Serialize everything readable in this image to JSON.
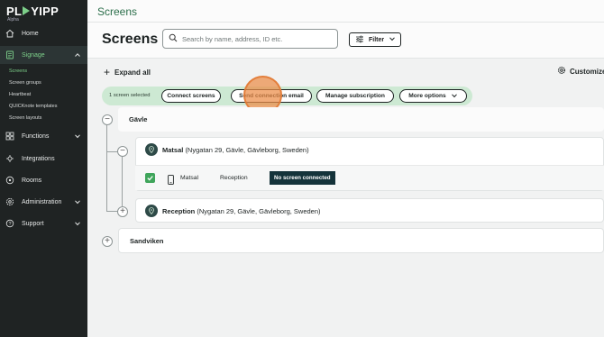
{
  "sidebar": {
    "logo": {
      "left": "PL",
      "right": "YIPP",
      "subtitle": "Alpha"
    },
    "items": [
      {
        "label": "Home",
        "icon": "home-icon"
      },
      {
        "label": "Signage",
        "icon": "signage-icon",
        "expanded": true,
        "active": true
      },
      {
        "label": "Functions",
        "icon": "functions-icon"
      },
      {
        "label": "Integrations",
        "icon": "integrations-icon"
      },
      {
        "label": "Rooms",
        "icon": "rooms-icon"
      },
      {
        "label": "Administration",
        "icon": "administration-icon"
      },
      {
        "label": "Support",
        "icon": "support-icon"
      }
    ],
    "signage_sub": [
      "Screens",
      "Screen groups",
      "Heartbeat",
      "QUICKnote templates",
      "Screen layouts"
    ]
  },
  "header": {
    "breadcrumb": "Screens"
  },
  "page": {
    "title": "Screens",
    "search_placeholder": "Search by name, address, ID etc.",
    "filter_label": "Filter",
    "expand_all": "Expand all",
    "customize": "Customize"
  },
  "selection": {
    "count_text": "1 screen selected",
    "actions": [
      "Connect screens",
      "Send connection email",
      "Manage subscription",
      "More options"
    ]
  },
  "tree": {
    "groups": [
      "Gävle",
      "Sandviken"
    ],
    "locations": [
      {
        "name": "Matsal",
        "address": "(Nygatan 29, Gävle, Gävleborg, Sweden)"
      },
      {
        "name": "Reception",
        "address": "(Nygatan 29, Gävle, Gävleborg, Sweden)"
      }
    ],
    "screen": {
      "name": "Matsal",
      "location": "Reception",
      "status": "No screen connected",
      "checked": true
    }
  },
  "colors": {
    "accent": "#7dd08a",
    "sidebar": "#1f2323",
    "selection_bar": "#cde9d3",
    "status_badge": "#14333a",
    "checkbox": "#3fa55b"
  }
}
